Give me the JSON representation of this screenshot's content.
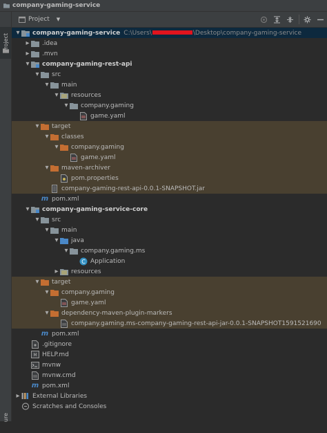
{
  "window": {
    "title": "company-gaming-service"
  },
  "side_tabs": {
    "project": "Project",
    "structure": "ure"
  },
  "toolbar": {
    "view_label": "Project",
    "icons": [
      "locate-icon",
      "expand-all-icon",
      "collapse-all-icon",
      "settings-icon",
      "hide-icon"
    ]
  },
  "colors": {
    "background": "#2b2b2b",
    "selected_row": "#0d293e",
    "excluded_row": "#494030",
    "folder": "#87939a",
    "source_folder": "#4a88c7",
    "excluded_folder": "#c46e32",
    "resources_folder": "#9aa07a"
  },
  "tree": {
    "root_label": "company-gaming-service",
    "root_path_prefix": "C:\\Users\\",
    "root_path_suffix": "\\Desktop\\company-gaming-service",
    "idea": ".idea",
    "mvn": ".mvn",
    "rest_api_module": "company-gaming-rest-api",
    "src": "src",
    "main": "main",
    "resources": "resources",
    "company_gaming": "company.gaming",
    "game_yaml": "game.yaml",
    "target": "target",
    "classes": "classes",
    "maven_archiver": "maven-archiver",
    "pom_properties": "pom.properties",
    "rest_api_jar": "company-gaming-rest-api-0.0.1-SNAPSHOT.jar",
    "pom_xml": "pom.xml",
    "core_module": "company-gaming-service-core",
    "java": "java",
    "company_gaming_ms": "company.gaming.ms",
    "application": "Application",
    "plugin_markers": "dependency-maven-plugin-markers",
    "marker_file": "company.gaming.ms-company-gaming-rest-api-jar-0.0.1-SNAPSHOT1591521690",
    "gitignore": ".gitignore",
    "help_md": "HELP.md",
    "mvnw": "mvnw",
    "mvnw_cmd": "mvnw.cmd",
    "external_libraries": "External Libraries",
    "scratches": "Scratches and Consoles"
  }
}
